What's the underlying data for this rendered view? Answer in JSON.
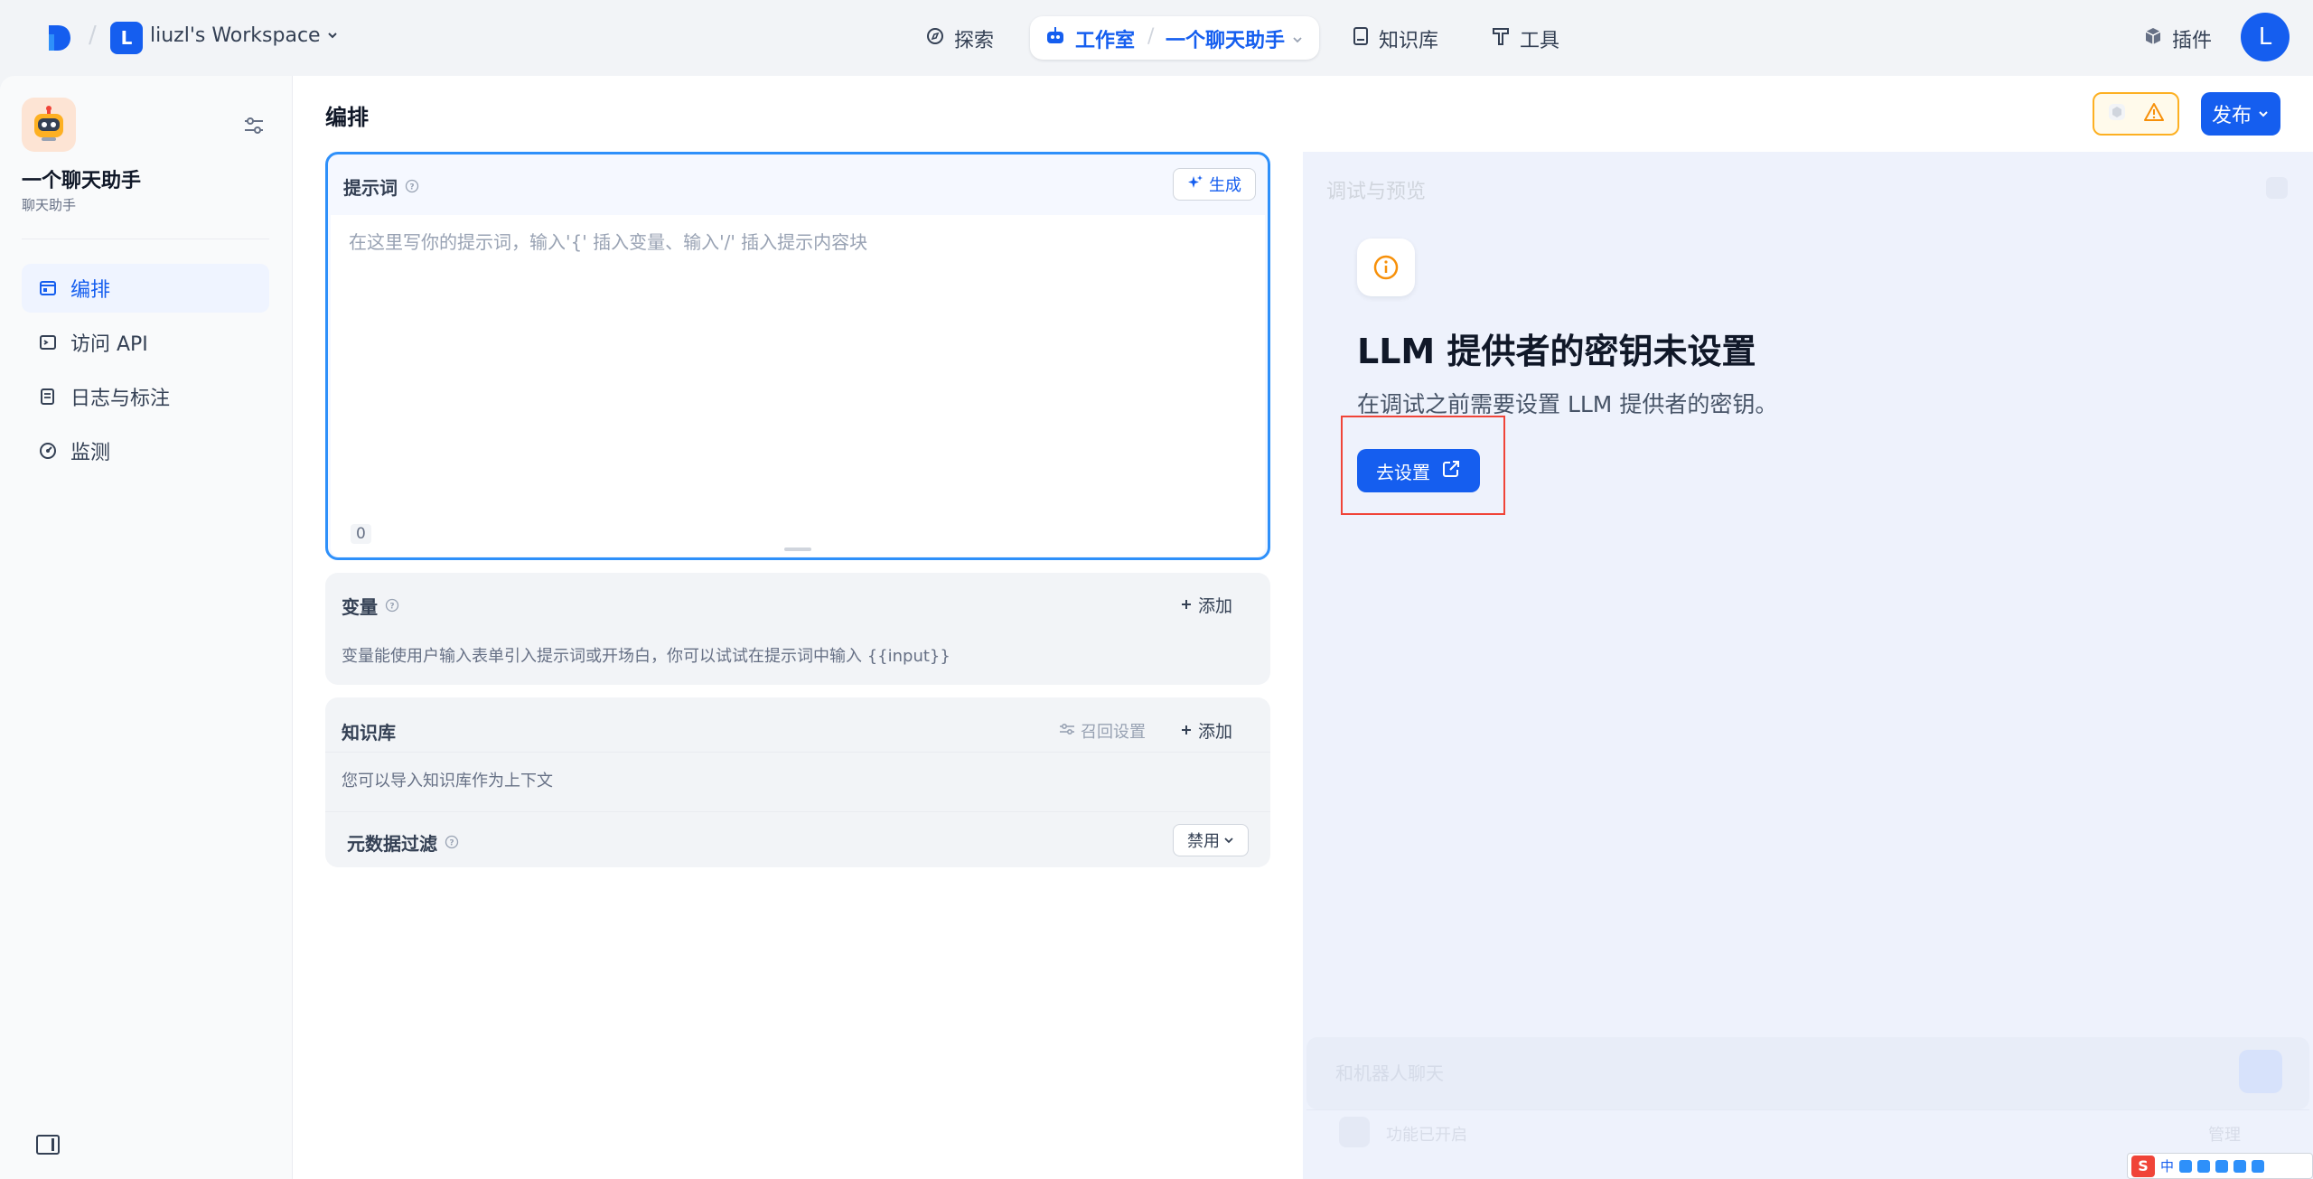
{
  "topnav": {
    "workspace_initial": "L",
    "workspace_name": "liuzl's Workspace",
    "explore": "探索",
    "studio": "工作室",
    "app_name": "一个聊天助手",
    "knowledge": "知识库",
    "tools": "工具",
    "plugins": "插件",
    "user_initial": "L"
  },
  "sidebar": {
    "app_name": "一个聊天助手",
    "app_type": "聊天助手",
    "items": [
      {
        "label": "编排",
        "icon": "layout-icon",
        "active": true
      },
      {
        "label": "访问 API",
        "icon": "terminal-icon",
        "active": false
      },
      {
        "label": "日志与标注",
        "icon": "file-list-icon",
        "active": false
      },
      {
        "label": "监测",
        "icon": "dashboard-icon",
        "active": false
      }
    ]
  },
  "main": {
    "title": "编排",
    "publish": "发布"
  },
  "prompt": {
    "label": "提示词",
    "generate": "生成",
    "placeholder": "在这里写你的提示词，输入'{' 插入变量、输入'/' 插入提示内容块",
    "value": "",
    "char_count": "0"
  },
  "variables": {
    "title": "变量",
    "add": "添加",
    "desc": "变量能使用户输入表单引入提示词或开场白，你可以试试在提示词中输入 {{input}}"
  },
  "knowledge": {
    "title": "知识库",
    "recall": "召回设置",
    "add": "添加",
    "desc": "您可以导入知识库作为上下文",
    "metadata_filter": "元数据过滤",
    "metadata_state": "禁用"
  },
  "debug": {
    "title": "调试与预览",
    "heading": "LLM 提供者的密钥未设置",
    "desc": "在调试之前需要设置 LLM 提供者的密钥。",
    "goto_btn": "去设置",
    "chat_placeholder": "和机器人聊天",
    "feature_label": "功能已开启",
    "feature_state": "管理"
  },
  "ime": {
    "lang": "中"
  },
  "colors": {
    "accent": "#155eef",
    "warning": "#f79009",
    "highlight": "#f04438"
  }
}
